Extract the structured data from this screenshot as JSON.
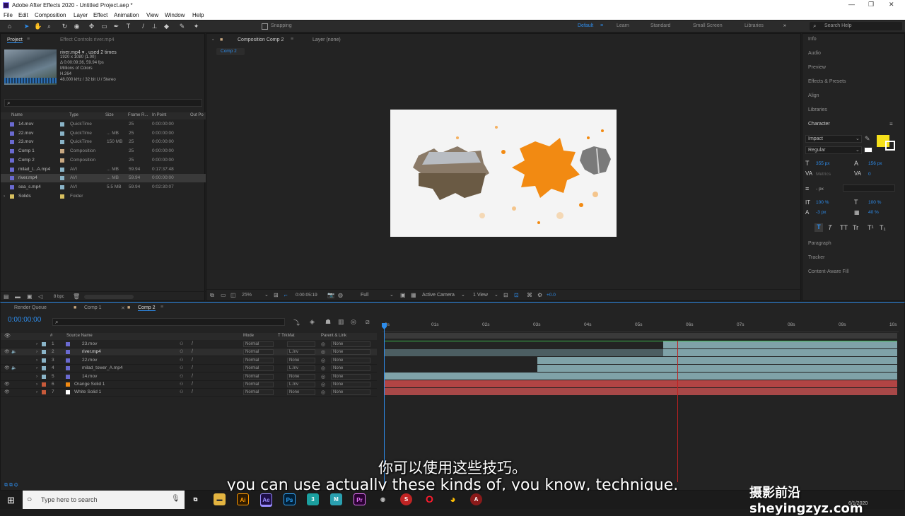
{
  "window": {
    "title": "Adobe After Effects 2020 - Untitled Project.aep *"
  },
  "menu": [
    "File",
    "Edit",
    "Composition",
    "Layer",
    "Effect",
    "Animation",
    "View",
    "Window",
    "Help"
  ],
  "toolbar": {
    "snapping": "Snapping",
    "workspaces": [
      "Default",
      "Learn",
      "Standard",
      "Small Screen",
      "Libraries"
    ],
    "search_help": "Search Help"
  },
  "project": {
    "tab": "Project",
    "tab2": "Effect Controls river.mp4",
    "file": "river.mp4 ▾ , used 2 times",
    "info": [
      "1920 x 1080 (1.00)",
      "Δ 0:00:09:36, 59.94 fps",
      "Millions of Colors",
      "H.264",
      "48.000 kHz / 32 bit U / Stereo"
    ],
    "columns": [
      "Name",
      "Type",
      "Size",
      "Frame R...",
      "In Point",
      "Out Po"
    ],
    "items": [
      {
        "name": "14.mov",
        "type": "QuickTime",
        "size": "",
        "fr": "25",
        "in": "0:00:00:00",
        "color": "#8ab4c8"
      },
      {
        "name": "22.mov",
        "type": "QuickTime",
        "size": "... MB",
        "fr": "25",
        "in": "0:00:00:00",
        "color": "#8ab4c8"
      },
      {
        "name": "23.mov",
        "type": "QuickTime",
        "size": "150 MB",
        "fr": "25",
        "in": "0:00:00:00",
        "color": "#8ab4c8"
      },
      {
        "name": "Comp 1",
        "type": "Composition",
        "size": "",
        "fr": "25",
        "in": "0:00:00:00",
        "color": "#c8a882"
      },
      {
        "name": "Comp 2",
        "type": "Composition",
        "size": "",
        "fr": "25",
        "in": "0:00:00:00",
        "color": "#c8a882"
      },
      {
        "name": "milad_t...A.mp4",
        "type": "AVI",
        "size": "... MB",
        "fr": "59.94",
        "in": "0:17:37:48",
        "color": "#8ab4c8"
      },
      {
        "name": "river.mp4",
        "type": "AVI",
        "size": "... MB",
        "fr": "59.94",
        "in": "0:00:00:00",
        "color": "#8ab4c8"
      },
      {
        "name": "sea_s.mp4",
        "type": "AVI",
        "size": "5.5 MB",
        "fr": "59.94",
        "in": "0:02:30:07",
        "color": "#8ab4c8"
      },
      {
        "name": "Solids",
        "type": "Folder",
        "size": "",
        "fr": "",
        "in": "",
        "color": "#d8c060"
      }
    ],
    "bpc": "8 bpc"
  },
  "composition": {
    "tab": "Composition Comp 2",
    "layer_tab": "Layer (none)",
    "subtab": "Comp 2",
    "zoom": "25%",
    "timecode": "0:00:05:19",
    "resolution": "Full",
    "camera": "Active Camera",
    "view": "1 View",
    "exposure": "+0.0"
  },
  "right_panel": {
    "items": [
      "Info",
      "Audio",
      "Preview",
      "Effects & Presets",
      "Align",
      "Libraries"
    ],
    "character": "Character",
    "font": "Impact",
    "style": "Regular",
    "size": "355 px",
    "leading": "156 px",
    "kerning": "Metrics",
    "tracking": "0",
    "stroke": "- px",
    "vscale": "100 %",
    "hscale": "100 %",
    "baseline": "-3 px",
    "tsume": "40 %",
    "fill_color": "#f5e01a",
    "lower": [
      "Paragraph",
      "Tracker",
      "Content-Aware Fill"
    ]
  },
  "timeline": {
    "tabs": [
      "Render Queue",
      "Comp 1",
      "Comp 2"
    ],
    "timecode": "0:00:00:00",
    "columns": [
      "#",
      "Source Name",
      "Mode",
      "T TrkMat",
      "Parent & Link"
    ],
    "ruler": [
      "0s",
      "01s",
      "02s",
      "03s",
      "04s",
      "05s",
      "06s",
      "07s",
      "08s",
      "09s",
      "10s"
    ],
    "layers": [
      {
        "n": "1",
        "name": "23.mov",
        "mode": "Normal",
        "trk": "",
        "parent": "None",
        "color": "#8ab4c8"
      },
      {
        "n": "2",
        "name": "river.mp4",
        "mode": "Normal",
        "trk": "L.Inv",
        "parent": "None",
        "color": "#8ab4c8"
      },
      {
        "n": "3",
        "name": "22.mov",
        "mode": "Normal",
        "trk": "None",
        "parent": "None",
        "color": "#8ab4c8"
      },
      {
        "n": "4",
        "name": "milad_tower_A.mp4",
        "mode": "Normal",
        "trk": "L.Inv",
        "parent": "None",
        "color": "#8ab4c8"
      },
      {
        "n": "5",
        "name": "14.mov",
        "mode": "Normal",
        "trk": "None",
        "parent": "None",
        "color": "#8ab4c8"
      },
      {
        "n": "6",
        "name": "Orange Solid 1",
        "mode": "Normal",
        "trk": "L.Inv",
        "parent": "None",
        "color": "#c85a3a"
      },
      {
        "n": "7",
        "name": "White Solid 1",
        "mode": "Normal",
        "trk": "None",
        "parent": "None",
        "color": "#c85a3a"
      }
    ]
  },
  "subtitles": {
    "cn": "你可以使用这些技巧。",
    "en": "you can use actually these kinds of, you know, technique."
  },
  "watermark": "摄影前沿 sheyingzyz.com",
  "taskbar": {
    "search": "Type here to search",
    "date": "6/1/2020"
  }
}
